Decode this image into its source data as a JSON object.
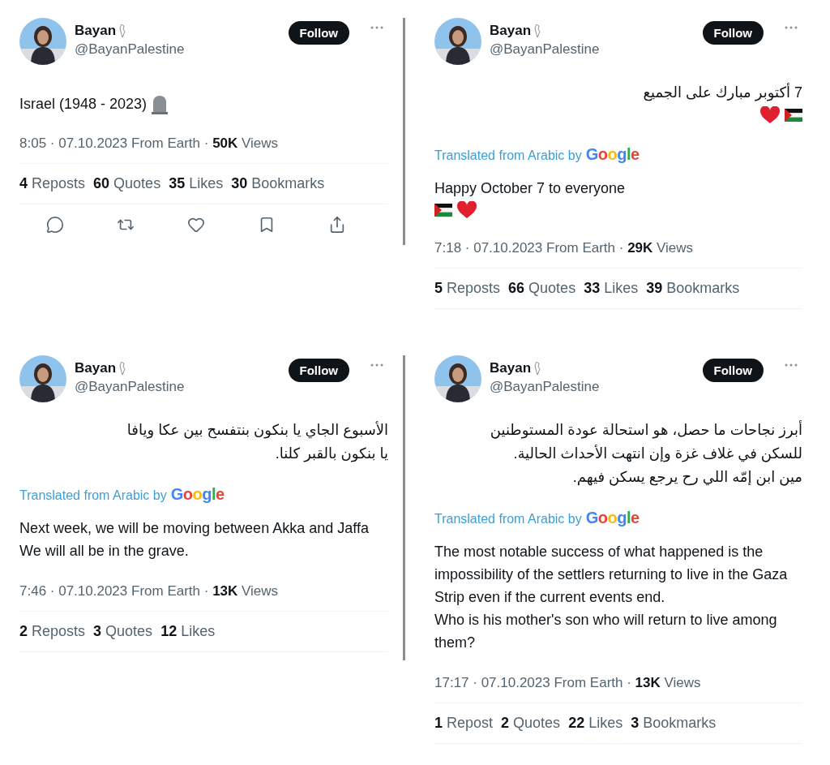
{
  "tweets": [
    {
      "name": "Bayan",
      "handle": "@BayanPalestine",
      "follow": "Follow",
      "original": [
        "Israel (1948 - 2023)"
      ],
      "original_icons": [
        {
          "kind": "headstone"
        }
      ],
      "meta": "8:05 · 07.10.2023 From Earth · **50K** Views",
      "stats": [
        "**4** Reposts",
        "**60** Quotes",
        "**35** Likes",
        "**30** Bookmarks"
      ],
      "actions": [
        {
          "kind": "reply"
        },
        {
          "kind": "repost"
        },
        {
          "kind": "like"
        },
        {
          "kind": "bookmark"
        },
        {
          "kind": "share"
        }
      ]
    },
    {
      "name": "Bayan",
      "handle": "@BayanPalestine",
      "follow": "Follow",
      "original": [
        "7 أكتوبر مبارك على الجميع"
      ],
      "right_to_left": true,
      "original_icons": [
        {
          "kind": "flag"
        },
        {
          "kind": "heart"
        }
      ],
      "translated_label": "Translated from Arabic by",
      "translator": "Google",
      "translation": [
        "Happy October 7 to everyone"
      ],
      "translation_icons": [
        {
          "kind": "flag"
        },
        {
          "kind": "heart"
        }
      ],
      "meta": "7:18 · 07.10.2023 From Earth · **29K** Views",
      "stats": [
        "**5** Reposts",
        "**66** Quotes",
        "**33** Likes",
        "**39** Bookmarks"
      ]
    },
    {
      "name": "Bayan",
      "handle": "@BayanPalestine",
      "follow": "Follow",
      "original": [
        "الأسبوع الجاي يا بنكون بنتفسح بين عكا ويافا",
        "يا بنكون بالقبر كلنا."
      ],
      "right_to_left": true,
      "translated_label": "Translated from Arabic by",
      "translator": "Google",
      "translation": [
        "Next week, we will be moving between Akka and Jaffa",
        "We will all be in the grave."
      ],
      "meta": "7:46 · 07.10.2023 From Earth · **13K** Views",
      "stats": [
        "**2** Reposts",
        "**3** Quotes",
        "**12** Likes"
      ]
    },
    {
      "name": "Bayan",
      "handle": "@BayanPalestine",
      "follow": "Follow",
      "original": [
        "أبرز نجاحات ما حصل، هو استحالة عودة المستوطنين",
        "للسكن في غلاف غزة وإن انتهت الأحداث الحالية.",
        "مين ابن إمّه اللي رح يرجع يسكن فيهم."
      ],
      "right_to_left": true,
      "translated_label": "Translated from Arabic by",
      "translator": "Google",
      "translation": [
        "The most notable success of what happened is the impossibility of the settlers returning to live in the Gaza Strip even if the current events end.",
        "Who is his mother's son who will return to live among them?"
      ],
      "meta": "17:17 · 07.10.2023 From Earth · **13K** Views",
      "stats": [
        "**1** Repost",
        "**2** Quotes",
        "**22** Likes",
        "**3** Bookmarks"
      ]
    }
  ]
}
